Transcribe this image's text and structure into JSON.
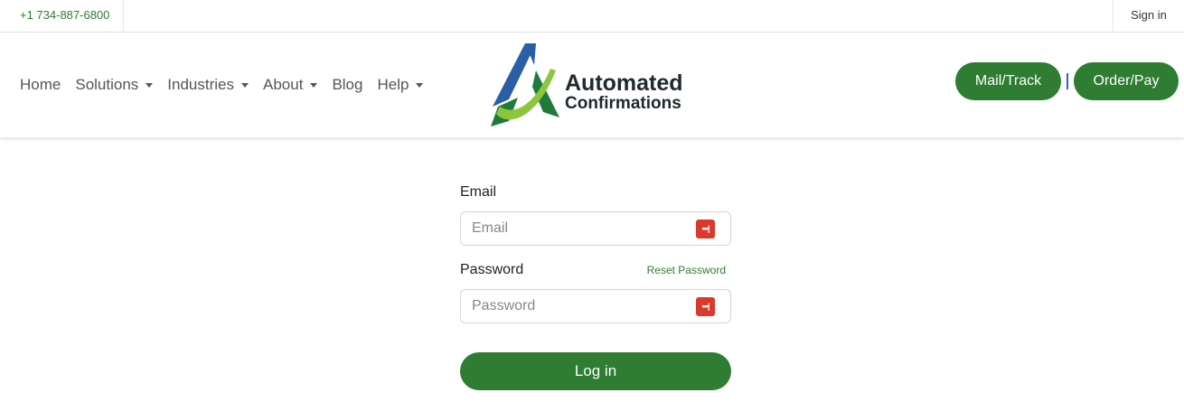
{
  "topbar": {
    "phone": "+1 734-887-6800",
    "sign_in": "Sign in"
  },
  "nav": {
    "items": [
      {
        "label": "Home",
        "dropdown": false
      },
      {
        "label": "Solutions",
        "dropdown": true
      },
      {
        "label": "Industries",
        "dropdown": true
      },
      {
        "label": "About",
        "dropdown": true
      },
      {
        "label": "Blog",
        "dropdown": false
      },
      {
        "label": "Help",
        "dropdown": true
      }
    ]
  },
  "logo": {
    "line1": "Automated",
    "line2": "Confirmations",
    "colors": {
      "blue": "#2a5fa5",
      "light_green": "#8cc63f",
      "dark_green": "#1e7b3a"
    }
  },
  "cta": {
    "mail_track": "Mail/Track",
    "order_pay": "Order/Pay"
  },
  "form": {
    "email_label": "Email",
    "email_placeholder": "Email",
    "email_value": "",
    "password_label": "Password",
    "password_placeholder": "Password",
    "password_value": "",
    "reset_link": "Reset Password",
    "submit": "Log in",
    "password_manager_icon": "password-manager-icon"
  },
  "colors": {
    "accent": "#2e7d32",
    "separator": "#3a5bd9",
    "password_icon": "#d93a2b"
  }
}
